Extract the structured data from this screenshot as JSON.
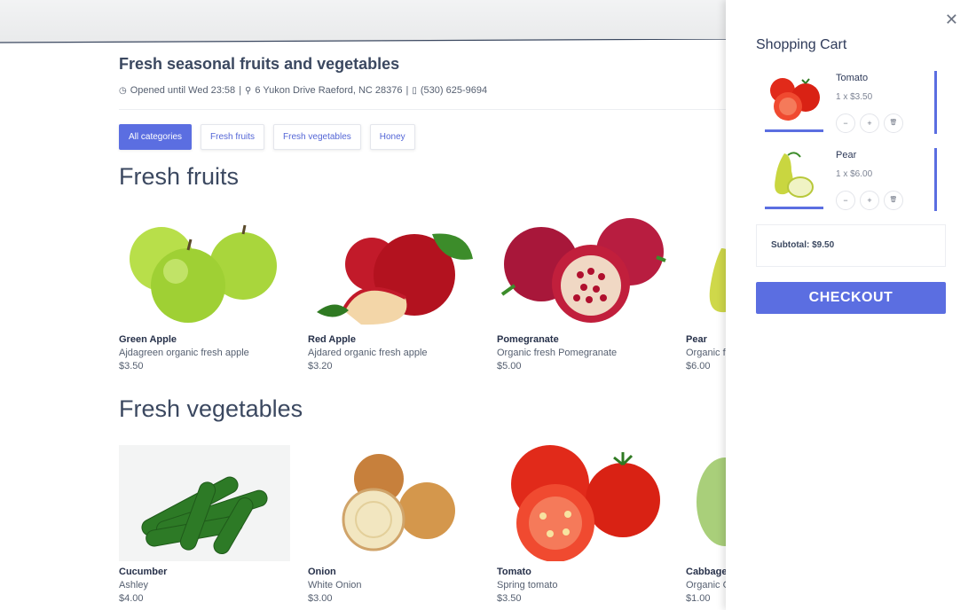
{
  "header": {
    "links": [
      "▢ ◦◦◦◦◦◦◦ ◦◦◦",
      "◦ ◦◦◦◦"
    ]
  },
  "store": {
    "title": "Fresh seasonal fruits and vegetables",
    "hours": "Opened until Wed 23:58",
    "address": "6 Yukon Drive Raeford, NC 28376",
    "phone": "(530) 625-9694",
    "separator": "|"
  },
  "filters": [
    {
      "label": "All categories",
      "active": true
    },
    {
      "label": "Fresh fruits",
      "active": false
    },
    {
      "label": "Fresh vegetables",
      "active": false
    },
    {
      "label": "Honey",
      "active": false
    }
  ],
  "sections": [
    {
      "title": "Fresh fruits",
      "products": [
        {
          "name": "Green Apple",
          "desc": "Ajdagreen organic fresh apple",
          "price": "$3.50",
          "icon": "green-apple"
        },
        {
          "name": "Red Apple",
          "desc": "Ajdared organic fresh apple",
          "price": "$3.20",
          "icon": "red-apple"
        },
        {
          "name": "Pomegranate",
          "desc": "Organic fresh Pomegranate",
          "price": "$5.00",
          "icon": "pomegranate"
        },
        {
          "name": "Pear",
          "desc": "Organic fresh yellow pear",
          "price": "$6.00",
          "icon": "pear"
        }
      ]
    },
    {
      "title": "Fresh vegetables",
      "products": [
        {
          "name": "Cucumber",
          "desc": "Ashley",
          "price": "$4.00",
          "icon": "cucumber"
        },
        {
          "name": "Onion",
          "desc": "White Onion",
          "price": "$3.00",
          "icon": "onion"
        },
        {
          "name": "Tomato",
          "desc": "Spring tomato",
          "price": "$3.50",
          "icon": "tomato"
        },
        {
          "name": "Cabbage",
          "desc": "Organic Cabbage",
          "price": "$1.00",
          "icon": "cabbage"
        }
      ]
    }
  ],
  "cart": {
    "title": "Shopping Cart",
    "close": "✕",
    "items": [
      {
        "name": "Tomato",
        "qty": "1 x $3.50",
        "icon": "tomato"
      },
      {
        "name": "Pear",
        "qty": "1 x $6.00",
        "icon": "pear"
      }
    ],
    "controls": {
      "minus": "−",
      "plus": "+",
      "remove": "🗑"
    },
    "subtotal": "Subtotal: $9.50",
    "checkout": "CHECKOUT"
  },
  "colors": {
    "accent": "#5b6ee1",
    "text": "#2e3a59",
    "muted": "#555f70"
  }
}
